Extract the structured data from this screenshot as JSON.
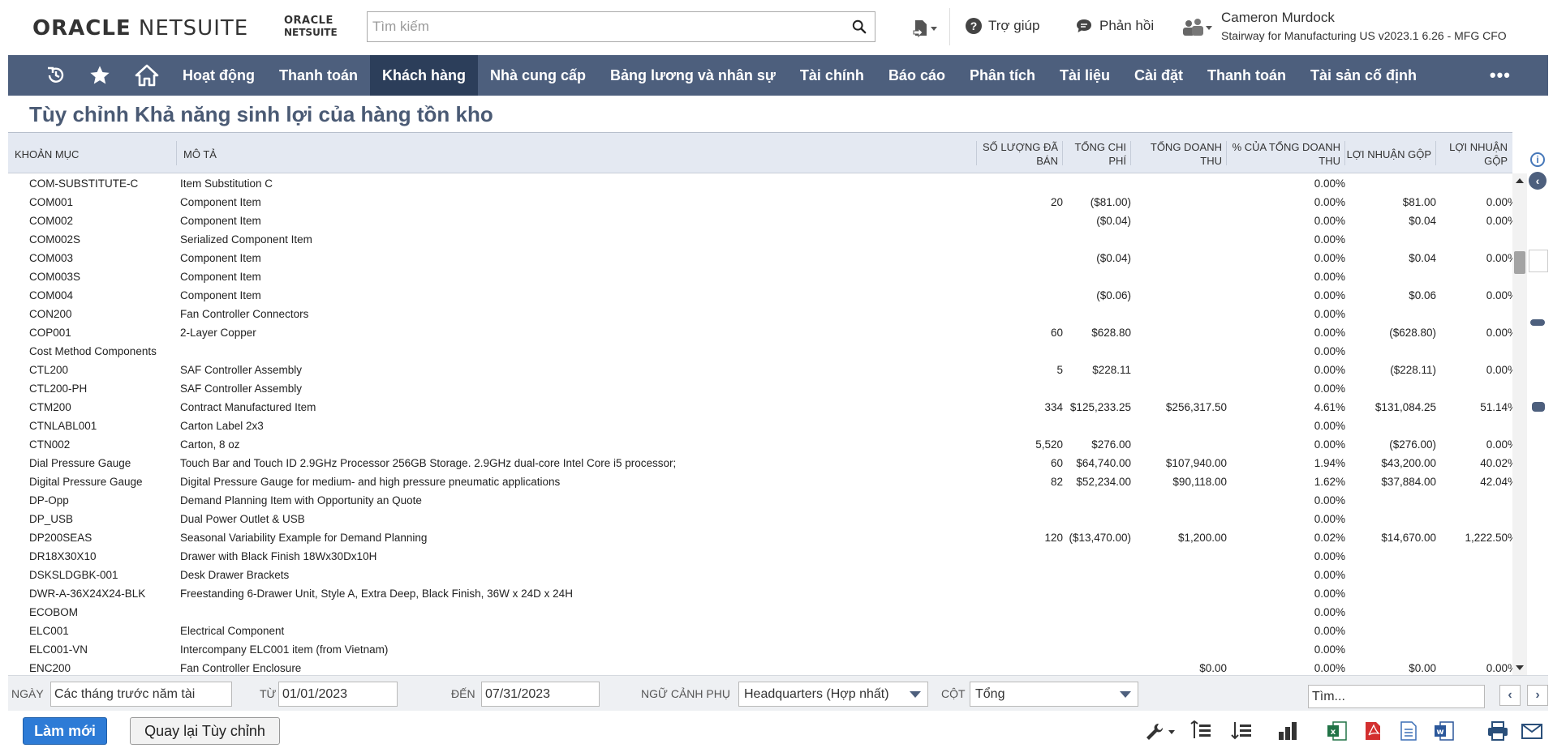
{
  "header": {
    "logo_bold": "ORACLE",
    "logo_light": "NETSUITE",
    "logo_small_line1": "ORACLE",
    "logo_small_line2": "NETSUITE",
    "search_placeholder": "Tìm kiếm",
    "help_label": "Trợ giúp",
    "feedback_label": "Phản hồi",
    "user_name": "Cameron Murdock",
    "user_role": "Stairway for Manufacturing US v2023.1 6.26 - MFG CFO"
  },
  "nav": {
    "items": [
      "Hoạt động",
      "Thanh toán",
      "Khách hàng",
      "Nhà cung cấp",
      "Bảng lương và nhân sự",
      "Tài chính",
      "Báo cáo",
      "Phân tích",
      "Tài liệu",
      "Cài đặt",
      "Thanh toán",
      "Tài sản cố định"
    ],
    "active": "Khách hàng",
    "more": "•••"
  },
  "page_title": "Tùy chỉnh Khả năng sinh lợi của hàng tồn kho",
  "table": {
    "columns": [
      "KHOẢN MỤC",
      "MÔ TẢ",
      "SỐ LƯỢNG ĐÃ BÁN",
      "TỔNG CHI PHÍ",
      "TỔNG DOANH THU",
      "% CỦA TỔNG DOANH THU",
      "LỢI NHUẬN GỘP",
      "LỢI NHUẬN GỘP"
    ],
    "rows": [
      [
        "COM-SUBSTITUTE-C",
        "Item Substitution C",
        "",
        "",
        "",
        "0.00%",
        "",
        ""
      ],
      [
        "COM001",
        "Component Item",
        "20",
        "($81.00)",
        "",
        "0.00%",
        "$81.00",
        "0.00%"
      ],
      [
        "COM002",
        "Component Item",
        "",
        "($0.04)",
        "",
        "0.00%",
        "$0.04",
        "0.00%"
      ],
      [
        "COM002S",
        "Serialized Component Item",
        "",
        "",
        "",
        "0.00%",
        "",
        ""
      ],
      [
        "COM003",
        "Component Item",
        "",
        "($0.04)",
        "",
        "0.00%",
        "$0.04",
        "0.00%"
      ],
      [
        "COM003S",
        "Component Item",
        "",
        "",
        "",
        "0.00%",
        "",
        ""
      ],
      [
        "COM004",
        "Component Item",
        "",
        "($0.06)",
        "",
        "0.00%",
        "$0.06",
        "0.00%"
      ],
      [
        "CON200",
        "Fan Controller Connectors",
        "",
        "",
        "",
        "0.00%",
        "",
        ""
      ],
      [
        "COP001",
        "2-Layer Copper",
        "60",
        "$628.80",
        "",
        "0.00%",
        "($628.80)",
        "0.00%"
      ],
      [
        "Cost Method Components",
        "",
        "",
        "",
        "",
        "0.00%",
        "",
        ""
      ],
      [
        "CTL200",
        "SAF Controller Assembly",
        "5",
        "$228.11",
        "",
        "0.00%",
        "($228.11)",
        "0.00%"
      ],
      [
        "CTL200-PH",
        "SAF Controller Assembly",
        "",
        "",
        "",
        "0.00%",
        "",
        ""
      ],
      [
        "CTM200",
        "Contract Manufactured Item",
        "334",
        "$125,233.25",
        "$256,317.50",
        "4.61%",
        "$131,084.25",
        "51.14%"
      ],
      [
        "CTNLABL001",
        "Carton Label 2x3",
        "",
        "",
        "",
        "0.00%",
        "",
        ""
      ],
      [
        "CTN002",
        "Carton, 8 oz",
        "5,520",
        "$276.00",
        "",
        "0.00%",
        "($276.00)",
        "0.00%"
      ],
      [
        "Dial Pressure Gauge",
        "Touch Bar and Touch ID 2.9GHz Processor 256GB Storage. 2.9GHz dual-core Intel Core i5 processor;",
        "60",
        "$64,740.00",
        "$107,940.00",
        "1.94%",
        "$43,200.00",
        "40.02%"
      ],
      [
        "Digital Pressure Gauge",
        "Digital Pressure Gauge for medium- and high pressure pneumatic applications",
        "82",
        "$52,234.00",
        "$90,118.00",
        "1.62%",
        "$37,884.00",
        "42.04%"
      ],
      [
        "DP-Opp",
        "Demand Planning Item with Opportunity an Quote",
        "",
        "",
        "",
        "0.00%",
        "",
        ""
      ],
      [
        "DP_USB",
        "Dual Power Outlet & USB",
        "",
        "",
        "",
        "0.00%",
        "",
        ""
      ],
      [
        "DP200SEAS",
        "Seasonal Variability Example for Demand Planning",
        "120",
        "($13,470.00)",
        "$1,200.00",
        "0.02%",
        "$14,670.00",
        "1,222.50%"
      ],
      [
        "DR18X30X10",
        "Drawer with Black Finish 18Wx30Dx10H",
        "",
        "",
        "",
        "0.00%",
        "",
        ""
      ],
      [
        "DSKSLDGBK-001",
        "Desk Drawer Brackets",
        "",
        "",
        "",
        "0.00%",
        "",
        ""
      ],
      [
        "DWR-A-36X24X24-BLK",
        "Freestanding 6-Drawer Unit, Style A, Extra Deep, Black Finish, 36W x 24D x 24H",
        "",
        "",
        "",
        "0.00%",
        "",
        ""
      ],
      [
        "ECOBOM",
        "",
        "",
        "",
        "",
        "0.00%",
        "",
        ""
      ],
      [
        "ELC001",
        "Electrical Component",
        "",
        "",
        "",
        "0.00%",
        "",
        ""
      ],
      [
        "ELC001-VN",
        "Intercompany ELC001 item (from Vietnam)",
        "",
        "",
        "",
        "0.00%",
        "",
        ""
      ],
      [
        "ENC200",
        "Fan Controller Enclosure",
        "",
        "",
        "$0.00",
        "0.00%",
        "$0.00",
        "0.00%"
      ]
    ]
  },
  "filters": {
    "date_label": "NGÀY",
    "date_value": "Các tháng trước năm tài",
    "from_label": "TỪ",
    "from_value": "01/01/2023",
    "to_label": "ĐẾN",
    "to_value": "07/31/2023",
    "context_label": "NGỮ CẢNH PHỤ",
    "context_value": "Headquarters (Hợp nhất)",
    "column_label": "CỘT",
    "column_value": "Tổng",
    "find_value": "Tìm..."
  },
  "buttons": {
    "refresh": "Làm mới",
    "back": "Quay lại Tùy chỉnh"
  },
  "colors": {
    "nav_bg": "#4d5f7d",
    "nav_active": "#2c3e5a",
    "title": "#4a5a74",
    "primary_button": "#2d7bd6",
    "table_header_bg": "#e4e9f2"
  }
}
